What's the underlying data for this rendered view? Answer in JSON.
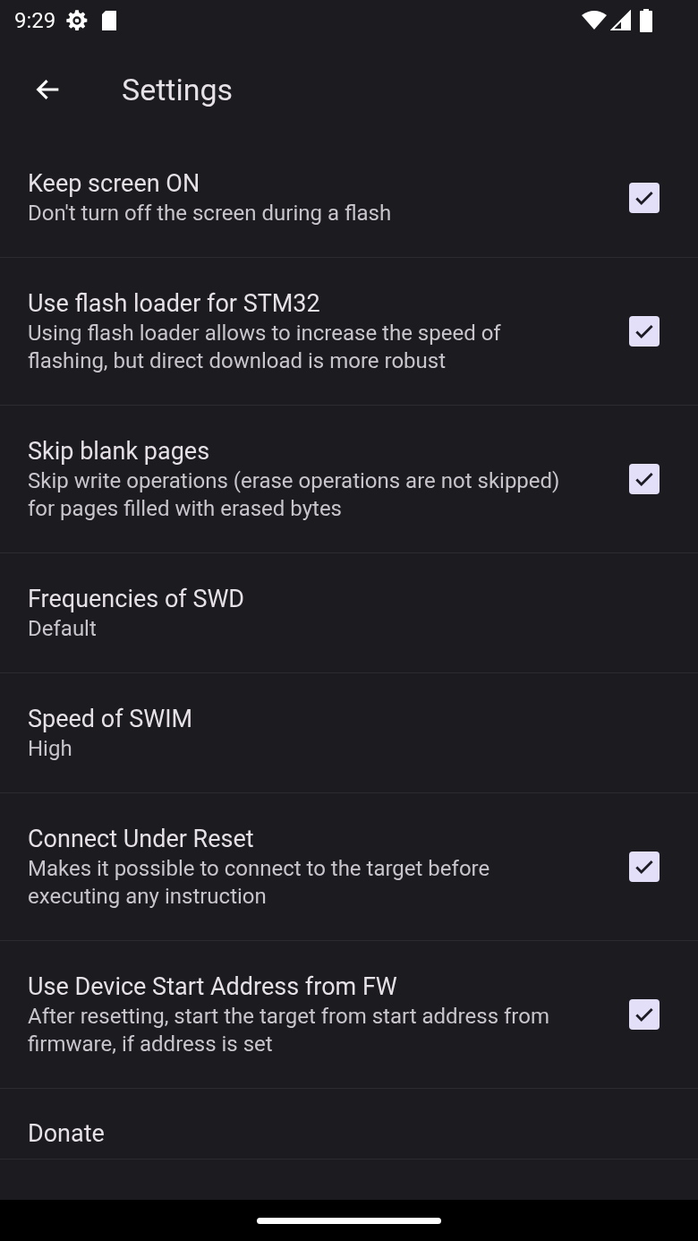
{
  "status_bar": {
    "time": "9:29"
  },
  "header": {
    "title": "Settings"
  },
  "settings": [
    {
      "kind": "checkbox",
      "title": "Keep screen ON",
      "summary": "Don't turn off the screen during a flash",
      "checked": true
    },
    {
      "kind": "checkbox",
      "title": "Use flash loader for STM32",
      "summary": "Using flash loader allows to increase the speed of flashing, but direct download is more robust",
      "checked": true
    },
    {
      "kind": "checkbox",
      "title": "Skip blank pages",
      "summary": "Skip write operations (erase operations are not skipped) for pages filled with erased bytes",
      "checked": true
    },
    {
      "kind": "value",
      "title": "Frequencies of SWD",
      "summary": "Default"
    },
    {
      "kind": "value",
      "title": "Speed of SWIM",
      "summary": "High"
    },
    {
      "kind": "checkbox",
      "title": "Connect Under Reset",
      "summary": "Makes it possible to connect to the target before executing any instruction",
      "checked": true
    },
    {
      "kind": "checkbox",
      "title": "Use Device Start Address from FW",
      "summary": "After resetting, start the target from start address from firmware, if address is set",
      "checked": true
    },
    {
      "kind": "plain",
      "title": "Donate"
    }
  ]
}
